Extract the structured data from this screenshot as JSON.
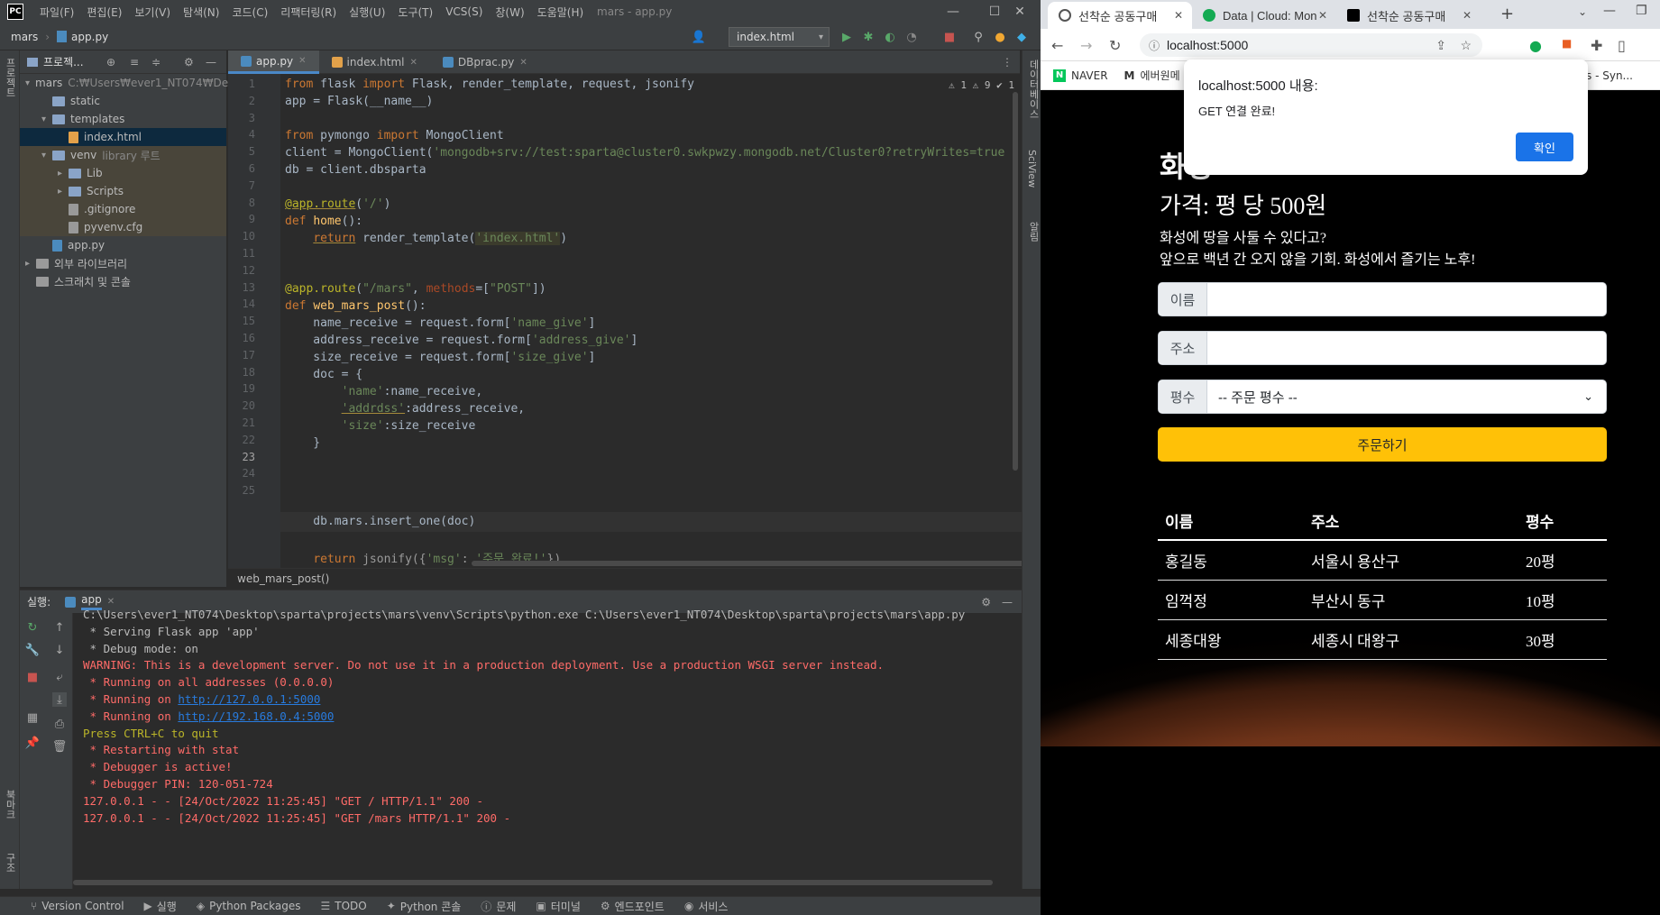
{
  "ide": {
    "logo": "PC",
    "menu": [
      "파일(F)",
      "편집(E)",
      "보기(V)",
      "탐색(N)",
      "코드(C)",
      "리팩터링(R)",
      "실행(U)",
      "도구(T)",
      "VCS(S)",
      "창(W)",
      "도움말(H)"
    ],
    "window_title": "mars - app.py",
    "breadcrumb": [
      "mars",
      "app.py"
    ],
    "run_config": "index.html",
    "project_header": "프로젝...",
    "tree": [
      {
        "label": "mars",
        "extra": "C:₩Users₩ever1_NT074₩De",
        "type": "folder",
        "indent": 0,
        "arrow": "▾"
      },
      {
        "label": "static",
        "type": "folder",
        "indent": 1,
        "arrow": ""
      },
      {
        "label": "templates",
        "type": "folder",
        "indent": 1,
        "arrow": "▾"
      },
      {
        "label": "index.html",
        "type": "html",
        "indent": 2,
        "arrow": ""
      },
      {
        "label": "venv",
        "extra": "library 루트",
        "type": "folder",
        "indent": 1,
        "arrow": "▾"
      },
      {
        "label": "Lib",
        "type": "folder",
        "indent": 2,
        "arrow": "▸"
      },
      {
        "label": "Scripts",
        "type": "folder",
        "indent": 2,
        "arrow": "▸"
      },
      {
        "label": ".gitignore",
        "type": "cfg",
        "indent": 2,
        "arrow": ""
      },
      {
        "label": "pyvenv.cfg",
        "type": "cfg",
        "indent": 2,
        "arrow": ""
      },
      {
        "label": "app.py",
        "type": "py",
        "indent": 1,
        "arrow": ""
      },
      {
        "label": "외부 라이브러리",
        "type": "lib",
        "indent": 0,
        "arrow": "▸"
      },
      {
        "label": "스크래치 및 콘솔",
        "type": "scratch",
        "indent": 0,
        "arrow": ""
      }
    ],
    "tabs": [
      "app.py",
      "index.html",
      "DBprac.py"
    ],
    "inspections": "⚠ 1  ⚠ 9  ✔ 1",
    "line_numbers": [
      "1",
      "2",
      "3",
      "4",
      "5",
      "6",
      "7",
      "8",
      "9",
      "10",
      "11",
      "12",
      "13",
      "14",
      "15",
      "16",
      "17",
      "18",
      "19",
      "20",
      "21",
      "22",
      "23",
      "24",
      "25"
    ],
    "code_function_crumb": "web_mars_post()",
    "run_label": "실행:",
    "run_tab": "app",
    "console": [
      {
        "text": "C:\\Users\\ever1_NT074\\Desktop\\sparta\\projects\\mars\\venv\\Scripts\\python.exe C:\\Users\\ever1_NT074\\Desktop\\sparta\\projects\\mars\\app.py",
        "cls": ""
      },
      {
        "text": " * Serving Flask app 'app'",
        "cls": ""
      },
      {
        "text": " * Debug mode: on",
        "cls": ""
      },
      {
        "text": "WARNING: This is a development server. Do not use it in a production deployment. Use a production WSGI server instead.",
        "cls": "red"
      },
      {
        "text": " * Running on all addresses (0.0.0.0)",
        "cls": "red"
      },
      {
        "text": " * Running on ",
        "cls": "red",
        "link": "http://127.0.0.1:5000"
      },
      {
        "text": " * Running on ",
        "cls": "red",
        "link": "http://192.168.0.4:5000"
      },
      {
        "text": "Press CTRL+C to quit",
        "cls": "yel"
      },
      {
        "text": " * Restarting with stat",
        "cls": "red"
      },
      {
        "text": " * Debugger is active!",
        "cls": "red"
      },
      {
        "text": " * Debugger PIN: 120-051-724",
        "cls": "red"
      },
      {
        "text": "127.0.0.1 - - [24/Oct/2022 11:25:45] \"GET / HTTP/1.1\" 200 -",
        "cls": "red"
      },
      {
        "text": "127.0.0.1 - - [24/Oct/2022 11:25:45] \"GET /mars HTTP/1.1\" 200 -",
        "cls": "red"
      }
    ],
    "status": [
      "Version Control",
      "실행",
      "Python Packages",
      "TODO",
      "Python 콘솔",
      "문제",
      "터미널",
      "엔드포인트",
      "서비스"
    ],
    "left_strip": [
      "프로젝트",
      "북마크",
      "구조"
    ],
    "right_strip": [
      "데이터베이스",
      "SciView",
      "알림"
    ]
  },
  "browser": {
    "tabs": [
      "선착순 공동구매",
      "Data | Cloud: Mon",
      "선착순 공동구매"
    ],
    "url": "localhost:5000",
    "bookmarks": [
      "NAVER",
      "에버원메",
      "s - Syn..."
    ],
    "alert": {
      "title": "localhost:5000 내용:",
      "message": "GET 연결 완료!",
      "ok": "확인"
    },
    "page": {
      "title": "화성",
      "price": "가격: 평 당 500원",
      "desc1": "화성에 땅을 사둘 수 있다고?",
      "desc2": "앞으로 백년 간 오지 않을 기회. 화성에서 즐기는 노후!",
      "name_label": "이름",
      "address_label": "주소",
      "size_label": "평수",
      "size_placeholder": "-- 주문 평수 --",
      "order_button": "주문하기",
      "table_headers": [
        "이름",
        "주소",
        "평수"
      ],
      "rows": [
        [
          "홍길동",
          "서울시 용산구",
          "20평"
        ],
        [
          "임꺽정",
          "부산시 동구",
          "10평"
        ],
        [
          "세종대왕",
          "세종시 대왕구",
          "30평"
        ]
      ]
    }
  },
  "colors": {
    "accent": "#4a88c7",
    "order_button": "#ffc107",
    "alert_ok": "#1a73e8"
  }
}
